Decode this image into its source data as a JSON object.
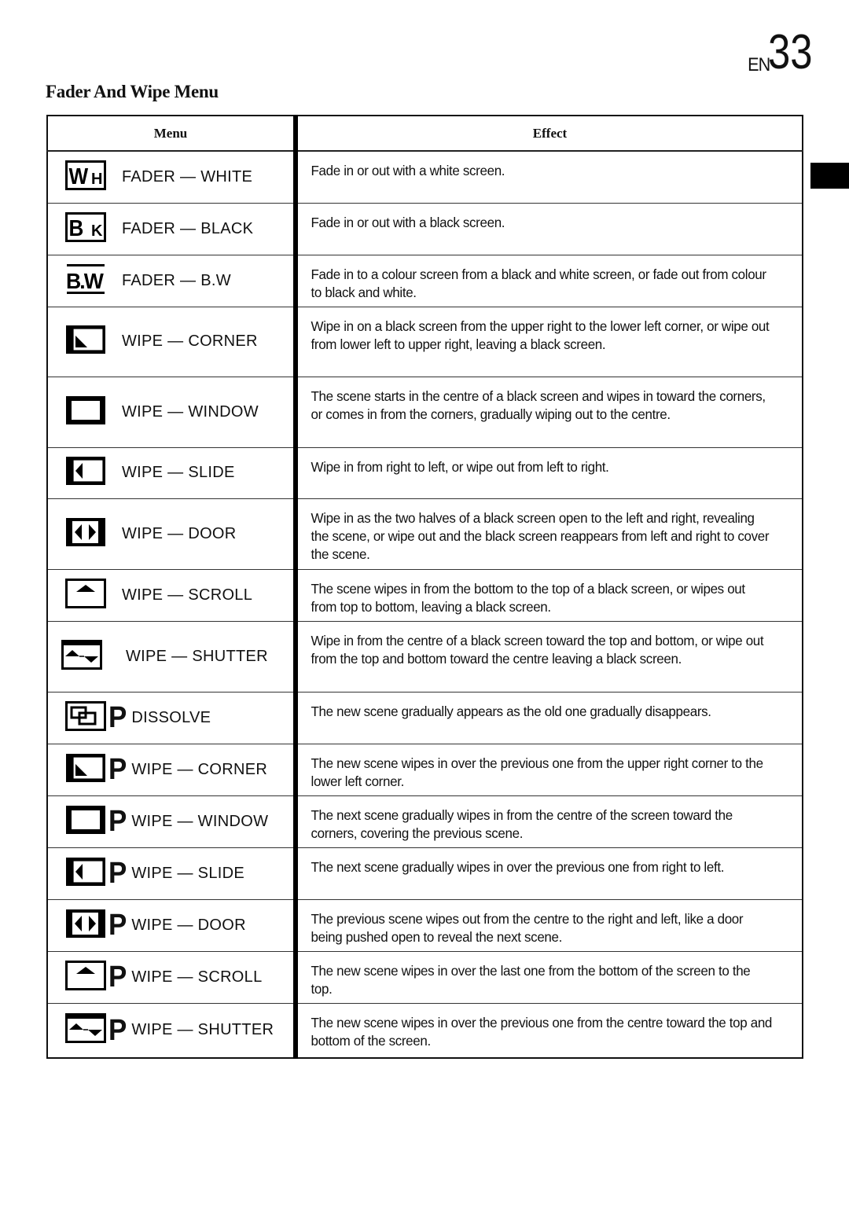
{
  "page": {
    "page_prefix": "EN",
    "page_number": "33",
    "section_title": "Fader And Wipe Menu"
  },
  "table": {
    "headers": {
      "menu": "Menu",
      "effect": "Effect"
    },
    "rows": [
      {
        "icon": "fader-white-icon",
        "icon_text": [
          "W",
          "H"
        ],
        "label": "FADER — WHITE",
        "effect": "Fade in or out with a white screen."
      },
      {
        "icon": "fader-black-icon",
        "icon_text": [
          "B",
          "K"
        ],
        "label": "FADER — BLACK",
        "effect": "Fade in or out with a black screen."
      },
      {
        "icon": "fader-bw-icon",
        "icon_text": [
          "B.W"
        ],
        "label": "FADER — B.W",
        "effect": "Fade in to a colour screen from a black and white screen, or fade out from colour to black and white."
      },
      {
        "icon": "wipe-corner-icon",
        "label": "WIPE — CORNER",
        "effect": "Wipe in on a black screen from the upper right to the lower left corner, or wipe out from lower left to upper right, leaving a black screen."
      },
      {
        "icon": "wipe-window-icon",
        "label": "WIPE — WINDOW",
        "effect": "The scene starts in the centre of a black screen and wipes in toward the corners, or comes in from the corners, gradually wiping out to the centre."
      },
      {
        "icon": "wipe-slide-icon",
        "label": "WIPE — SLIDE",
        "effect": "Wipe in from right to left, or wipe out from left to right."
      },
      {
        "icon": "wipe-door-icon",
        "label": "WIPE — DOOR",
        "effect": "Wipe in as the two halves of a black screen open to the left and right, revealing the scene, or wipe out and the black screen reappears from left and right to cover the scene."
      },
      {
        "icon": "wipe-scroll-icon",
        "label": "WIPE — SCROLL",
        "effect": "The scene wipes in from the bottom to the top of a black screen, or wipes out from top to bottom, leaving a black screen."
      },
      {
        "icon": "wipe-shutter-icon",
        "label": "WIPE — SHUTTER",
        "effect": "Wipe in from the centre of a black screen toward the top and bottom, or wipe out from the top and bottom toward the centre leaving a black screen."
      },
      {
        "icon": "dissolve-icon",
        "p_mark": "P",
        "label": "DISSOLVE",
        "effect": "The new scene gradually appears as the old one gradually disappears."
      },
      {
        "icon": "p-wipe-corner-icon",
        "p_mark": "P",
        "label": "WIPE — CORNER",
        "effect": "The new scene wipes in over the previous one from the upper right corner to the lower left corner."
      },
      {
        "icon": "p-wipe-window-icon",
        "p_mark": "P",
        "label": "WIPE — WINDOW",
        "effect": "The next scene gradually wipes in from the centre of the screen toward the corners, covering the previous scene."
      },
      {
        "icon": "p-wipe-slide-icon",
        "p_mark": "P",
        "label": "WIPE — SLIDE",
        "effect": "The next scene gradually wipes in over the previous one from right to left."
      },
      {
        "icon": "p-wipe-door-icon",
        "p_mark": "P",
        "label": "WIPE — DOOR",
        "effect": "The previous scene wipes out from the centre to the right and left, like a door being pushed open to reveal the next scene."
      },
      {
        "icon": "p-wipe-scroll-icon",
        "p_mark": "P",
        "label": "WIPE — SCROLL",
        "effect": "The new scene wipes in over the last one from the bottom of the screen to the top."
      },
      {
        "icon": "p-wipe-shutter-icon",
        "p_mark": "P",
        "label": "WIPE — SHUTTER",
        "effect": "The new scene wipes in over the previous one from the centre toward the top and bottom of the screen."
      }
    ]
  }
}
